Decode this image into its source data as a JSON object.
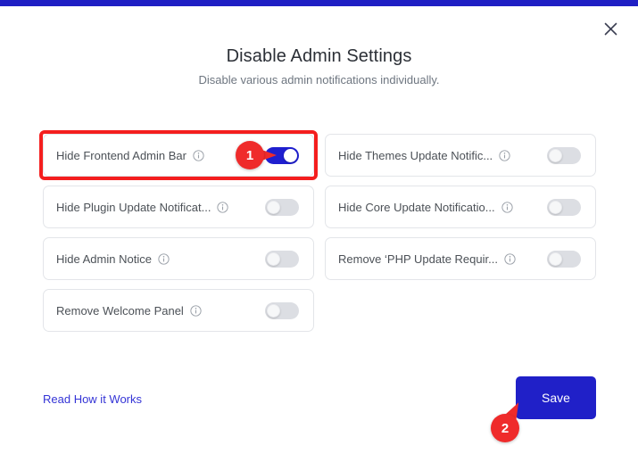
{
  "theme": {
    "accent_blue": "#1f1fc4",
    "save_blue": "#2020c8",
    "toggle_on_blue": "#1f1fcf",
    "toggle_off_gray": "#dcdee3",
    "annotation_red": "#ef2b2b",
    "highlight_red": "#f41e1e",
    "link_blue": "#3434d6"
  },
  "topbar": {
    "name": "top-accent-bar"
  },
  "header": {
    "title": "Disable Admin Settings",
    "subtitle": "Disable various admin notifications individually.",
    "close_icon": "close-icon"
  },
  "settings": [
    {
      "label": "Hide Frontend Admin Bar",
      "info_icon": "info-icon",
      "state": "on",
      "highlighted": true,
      "column": "left"
    },
    {
      "label": "Hide Themes Update Notific...",
      "info_icon": "info-icon",
      "state": "off",
      "highlighted": false,
      "column": "right"
    },
    {
      "label": "Hide Plugin Update Notificat...",
      "info_icon": "info-icon",
      "state": "off",
      "highlighted": false,
      "column": "left"
    },
    {
      "label": "Hide Core Update Notificatio...",
      "info_icon": "info-icon",
      "state": "off",
      "highlighted": false,
      "column": "right"
    },
    {
      "label": "Hide Admin Notice",
      "info_icon": "info-icon",
      "state": "off",
      "highlighted": false,
      "column": "left"
    },
    {
      "label": "Remove ‘PHP Update Requir...",
      "info_icon": "info-icon",
      "state": "off",
      "highlighted": false,
      "column": "right"
    },
    {
      "label": "Remove Welcome Panel",
      "info_icon": "info-icon",
      "state": "off",
      "highlighted": false,
      "column": "left"
    }
  ],
  "footer": {
    "read_link": "Read How it Works",
    "save_label": "Save"
  },
  "annotations": [
    {
      "number": "1",
      "target": "hide-frontend-admin-bar-toggle"
    },
    {
      "number": "2",
      "target": "save-button"
    }
  ]
}
